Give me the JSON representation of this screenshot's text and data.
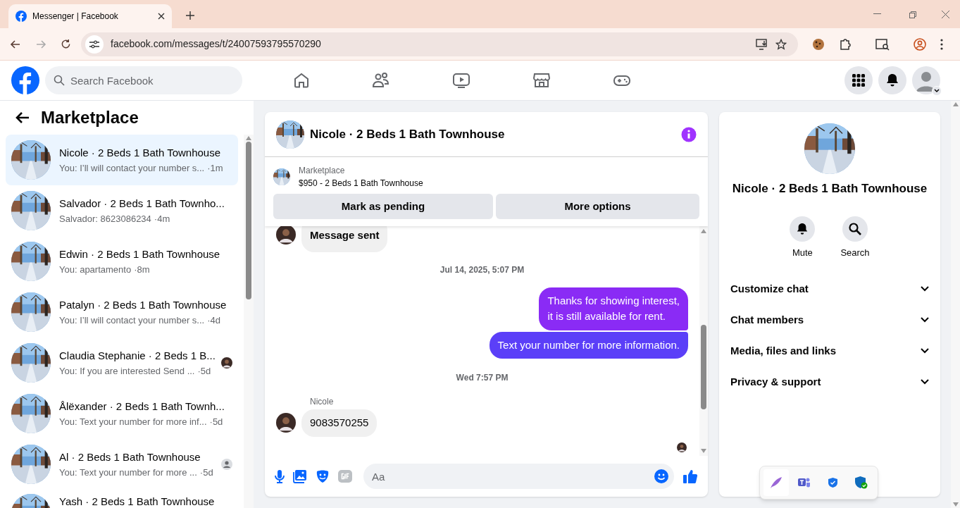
{
  "browser": {
    "tab_title": "Messenger | Facebook",
    "url": "facebook.com/messages/t/24007593795570290"
  },
  "header": {
    "search_placeholder": "Search Facebook"
  },
  "sidebar": {
    "title": "Marketplace",
    "conversations": [
      {
        "name": "Nicole · 2 Beds 1 Bath Townhouse",
        "preview": "You: I’ll will contact your number s...",
        "time": "·1m",
        "selected": true
      },
      {
        "name": "Salvador · 2 Beds 1 Bath Townho...",
        "preview": "Salvador: 8623086234",
        "time": "·4m",
        "selected": false
      },
      {
        "name": "Edwin · 2 Beds 1 Bath Townhouse",
        "preview": "You: apartamento",
        "time": "·8m",
        "selected": false
      },
      {
        "name": "Patalyn · 2 Beds 1 Bath Townhouse",
        "preview": "You: I’ll will contact your number s...",
        "time": "·4d",
        "selected": false
      },
      {
        "name": "Claudia Stephanie · 2 Beds 1 B...",
        "preview": "You: If you are interested Send ...",
        "time": "·5d",
        "selected": false
      },
      {
        "name": "Ålëxander · 2 Beds 1 Bath Townh...",
        "preview": "You: Text your number for more inf...",
        "time": "·5d",
        "selected": false
      },
      {
        "name": "Al · 2 Beds 1 Bath Townhouse",
        "preview": "You: Text your number for more ...",
        "time": "·5d",
        "selected": false,
        "receipt": {
          "kind": "generic"
        }
      },
      {
        "name": "Yash · 2 Beds 1 Bath Townhouse",
        "selected": false
      }
    ]
  },
  "chat": {
    "title": "Nicole · 2 Beds 1 Bath Townhouse",
    "listing": {
      "label": "Marketplace",
      "title": "$950 - 2 Beds 1 Bath Townhouse"
    },
    "buttons": [
      "Mark as pending",
      "More options"
    ],
    "messages": [
      {
        "kind": "incoming",
        "text": "Message sent"
      },
      {
        "kind": "timestamp",
        "text": "Jul 14, 2025, 5:07 PM"
      },
      {
        "kind": "outgoing",
        "text": "Thanks for showing interest,\nit is still available for rent."
      },
      {
        "kind": "outgoing",
        "text": "Text your number for more information."
      },
      {
        "kind": "timestamp",
        "text": "Wed 7:57 PM"
      },
      {
        "kind": "sender",
        "text": "Nicole"
      },
      {
        "kind": "incoming",
        "text": "9083570255"
      }
    ],
    "composer_placeholder": "Aa"
  },
  "details": {
    "name": "Nicole · 2 Beds 1 Bath Townhouse",
    "actions": [
      {
        "kind": "mute",
        "label": "Mute"
      },
      {
        "kind": "search",
        "label": "Search"
      }
    ],
    "sections": [
      "Customize chat",
      "Chat members",
      "Media, files and links",
      "Privacy & support"
    ]
  }
}
